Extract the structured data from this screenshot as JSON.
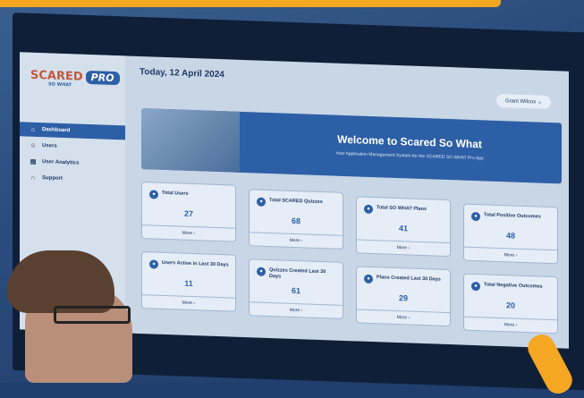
{
  "app": {
    "brand": "SCARED",
    "brand_sub": "SO WHAT",
    "badge": "PRO"
  },
  "sidebar": {
    "items": [
      {
        "label": "Dashboard",
        "icon": "home-icon",
        "active": true
      },
      {
        "label": "Users",
        "icon": "users-icon",
        "active": false
      },
      {
        "label": "User Analytics",
        "icon": "analytics-icon",
        "active": false
      },
      {
        "label": "Support",
        "icon": "headset-icon",
        "active": false
      }
    ]
  },
  "header": {
    "date": "Today, 12 April 2024",
    "user": "Grant Wilcox"
  },
  "banner": {
    "title": "Welcome to Scared So What",
    "subtitle": "Your Application Management System for the SCARED SO WHAT Pro App"
  },
  "cards": [
    {
      "label": "Total Users",
      "value": "27",
      "more": "More ›"
    },
    {
      "label": "Total SCARED Quizzes",
      "value": "68",
      "more": "More ›"
    },
    {
      "label": "Total SO WHAT Plans",
      "value": "41",
      "more": "More ›"
    },
    {
      "label": "Total Positive Outcomes",
      "value": "48",
      "more": "More ›"
    },
    {
      "label": "Users Active in Last 30 Days",
      "value": "11",
      "more": "More ›"
    },
    {
      "label": "Quizzes Created Last 30 Days",
      "value": "61",
      "more": "More ›"
    },
    {
      "label": "Plans Created Last 30 Days",
      "value": "29",
      "more": "More ›"
    },
    {
      "label": "Total Negative Outcomes",
      "value": "20",
      "more": "More ›"
    }
  ],
  "colors": {
    "accent": "#2d5fa6",
    "highlight": "#f5a623"
  }
}
